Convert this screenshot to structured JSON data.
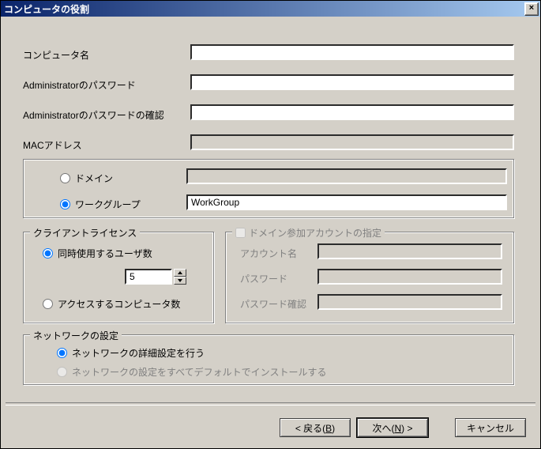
{
  "title": "コンピュータの役割",
  "labels": {
    "computer_name": "コンピュータ名",
    "admin_password": "Administratorのパスワード",
    "admin_password_confirm": "Administratorのパスワードの確認",
    "mac_address": "MACアドレス"
  },
  "fields": {
    "computer_name": "",
    "admin_password": "",
    "admin_password_confirm": "",
    "mac_address": ""
  },
  "membership": {
    "domain_label": "ドメイン",
    "workgroup_label": "ワークグループ",
    "selected": "workgroup",
    "domain_value": "",
    "workgroup_value": "WorkGroup"
  },
  "client_license": {
    "legend": "クライアントライセンス",
    "per_seat_label": "同時使用するユーザ数",
    "per_server_label": "アクセスするコンピュータ数",
    "selected": "per_seat",
    "count": "5"
  },
  "domain_account": {
    "legend": "ドメイン参加アカウントの指定",
    "enabled": false,
    "account_label": "アカウント名",
    "password_label": "パスワード",
    "password_confirm_label": "パスワード確認",
    "account_value": "",
    "password_value": "",
    "password_confirm_value": ""
  },
  "network": {
    "legend": "ネットワークの設定",
    "custom_label": "ネットワークの詳細設定を行う",
    "default_label": "ネットワークの設定をすべてデフォルトでインストールする",
    "selected": "custom"
  },
  "buttons": {
    "back_prefix": "< 戻る(",
    "back_key": "B",
    "back_suffix": ")",
    "next_prefix": "次へ(",
    "next_key": "N",
    "next_suffix": ") >",
    "cancel": "キャンセル"
  }
}
